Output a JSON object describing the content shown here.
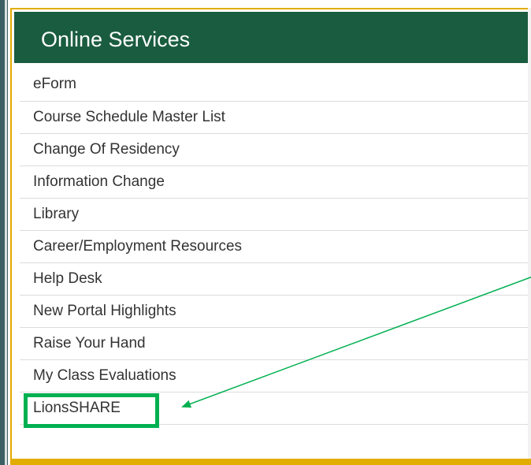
{
  "panel": {
    "title": "Online Services"
  },
  "services": [
    {
      "label": "eForm"
    },
    {
      "label": "Course Schedule Master List"
    },
    {
      "label": "Change Of Residency"
    },
    {
      "label": "Information Change"
    },
    {
      "label": "Library"
    },
    {
      "label": "Career/Employment Resources"
    },
    {
      "label": "Help Desk"
    },
    {
      "label": "New Portal Highlights"
    },
    {
      "label": "Raise Your Hand"
    },
    {
      "label": "My Class Evaluations"
    },
    {
      "label": "LionsSHARE"
    }
  ],
  "colors": {
    "header_background": "#1a5c3f",
    "panel_border": "#e2ac00",
    "highlight_annotation": "#00b050",
    "text": "#333333"
  },
  "annotation": {
    "highlighted_item": "LionsSHARE",
    "type": "arrow-and-box"
  }
}
